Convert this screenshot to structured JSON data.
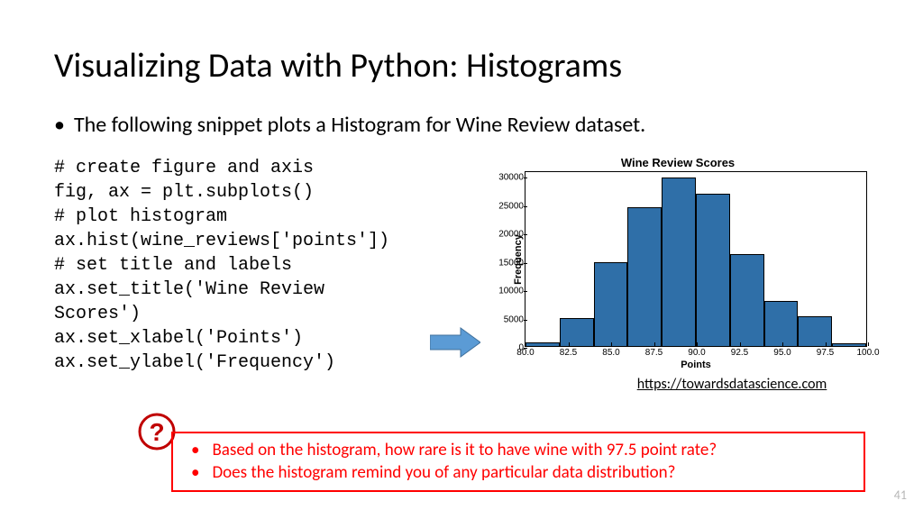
{
  "title": "Visualizing Data with Python: Histograms",
  "main_bullet": "The following snippet plots a Histogram for Wine Review dataset.",
  "code": "# create figure and axis\nfig, ax = plt.subplots()\n# plot histogram\nax.hist(wine_reviews['points'])\n# set title and labels\nax.set_title('Wine Review\nScores')\nax.set_xlabel('Points')\nax.set_ylabel('Frequency')",
  "link": "https://towardsdatascience.com",
  "callout": {
    "q1": "Based on the histogram, how rare is it to have wine with 97.5 point rate?",
    "q2": "Does the histogram remind you of any particular data distribution?"
  },
  "page_number": "41",
  "chart_data": {
    "type": "bar",
    "title": "Wine Review Scores",
    "xlabel": "Points",
    "ylabel": "Frequency",
    "xticks": [
      "80.0",
      "82.5",
      "85.0",
      "87.5",
      "90.0",
      "92.5",
      "95.0",
      "97.5",
      "100.0"
    ],
    "yticks": [
      "0",
      "5000",
      "10000",
      "15000",
      "20000",
      "25000",
      "30000"
    ],
    "ylim": [
      0,
      31000
    ],
    "categories": [
      "80-82",
      "82-84",
      "84-86",
      "86-88",
      "88-90",
      "90-92",
      "92-94",
      "94-96",
      "96-98",
      "98-100"
    ],
    "values": [
      600,
      5000,
      14800,
      24500,
      29800,
      26800,
      16200,
      7900,
      5200,
      500
    ]
  }
}
